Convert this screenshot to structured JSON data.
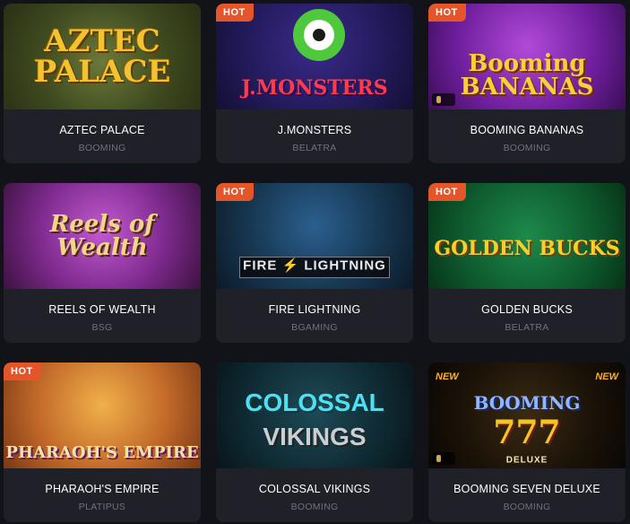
{
  "games": [
    {
      "name": "AZTEC PALACE",
      "provider": "BOOMING",
      "hot": false,
      "art": {
        "title": "AZTEC PALACE"
      }
    },
    {
      "name": "J.MONSTERS",
      "provider": "BELATRA",
      "hot": true,
      "art": {
        "title": "J.MONSTERS"
      }
    },
    {
      "name": "BOOMING BANANAS",
      "provider": "BOOMING",
      "hot": true,
      "art": {
        "title": "Booming BANANAS"
      }
    },
    {
      "name": "REELS OF WEALTH",
      "provider": "BSG",
      "hot": false,
      "art": {
        "title": "Reels of Wealth"
      }
    },
    {
      "name": "FIRE LIGHTNING",
      "provider": "BGAMING",
      "hot": true,
      "art": {
        "title": "FIRE ⚡ LIGHTNING"
      }
    },
    {
      "name": "GOLDEN BUCKS",
      "provider": "BELATRA",
      "hot": true,
      "art": {
        "title": "GOLDEN BUCKS"
      }
    },
    {
      "name": "PHARAOH'S EMPIRE",
      "provider": "PLATIPUS",
      "hot": true,
      "art": {
        "title": "PHARAOH'S EMPIRE"
      }
    },
    {
      "name": "COLOSSAL VIKINGS",
      "provider": "BOOMING",
      "hot": false,
      "art": {
        "title": "COLOSSAL",
        "subtitle": "VIKINGS"
      }
    },
    {
      "name": "BOOMING SEVEN DELUXE",
      "provider": "BOOMING",
      "hot": false,
      "art": {
        "title": "BOOMING",
        "sevens": "777",
        "subtitle": "DELUXE",
        "new_left": "NEW",
        "new_right": "NEW"
      }
    }
  ],
  "badge_label": "HOT",
  "colors": {
    "background": "#121319",
    "card": "#1f2028",
    "hot_badge": "#e4552a",
    "provider_text": "#70727c"
  }
}
